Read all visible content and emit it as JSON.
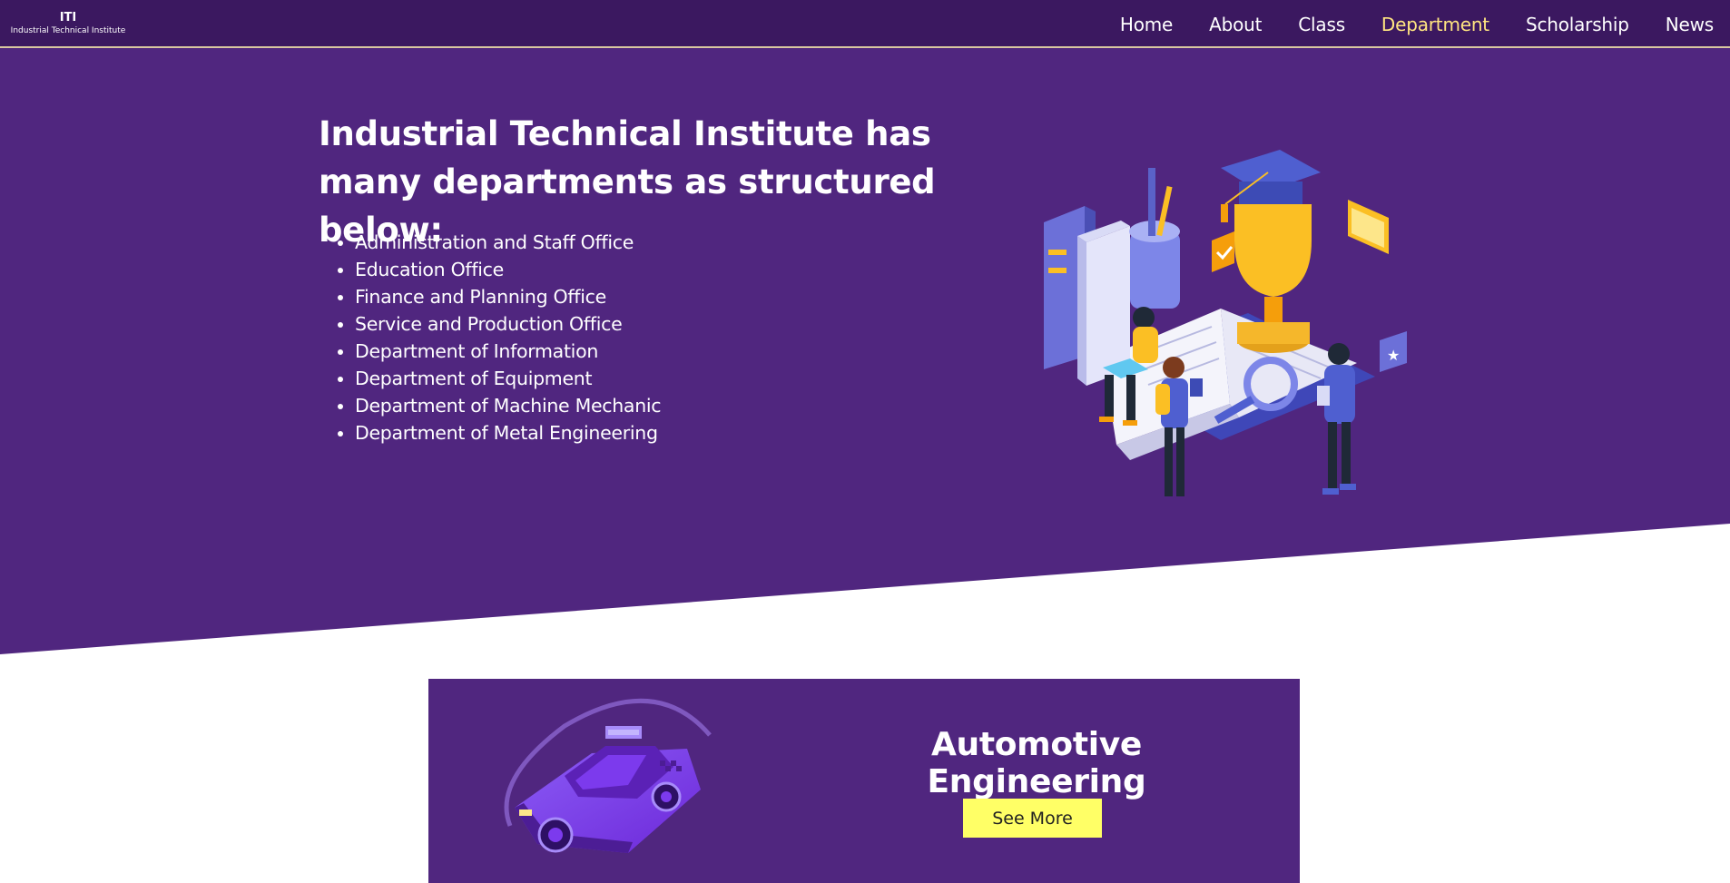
{
  "brand": {
    "short": "ITI",
    "full": "Industrial Technical Institute"
  },
  "nav": {
    "items": [
      {
        "label": "Home"
      },
      {
        "label": "About"
      },
      {
        "label": "Class"
      },
      {
        "label": "Department",
        "active": true
      },
      {
        "label": "Scholarship"
      },
      {
        "label": "News"
      }
    ]
  },
  "hero": {
    "title": "Industrial Technical Institute has many departments as structured below:",
    "departments": [
      "Administration and Staff Office",
      "Education Office",
      "Finance and Planning Office",
      "Service and Production Office",
      "Department of Information",
      "Department of Equipment",
      "Department of Machine Mechanic",
      "Department of Metal Engineering"
    ]
  },
  "card": {
    "title": "Automotive Engineering",
    "button_label": "See More"
  },
  "colors": {
    "nav_bg": "#3b1860",
    "hero_bg": "#50267f",
    "active_link": "#ffe580",
    "button_bg": "#ffff66",
    "accent_yellow": "#fbbf24",
    "accent_blue": "#4f5fd0"
  },
  "icons": [
    "education-illustration",
    "taxi-car-illustration"
  ]
}
